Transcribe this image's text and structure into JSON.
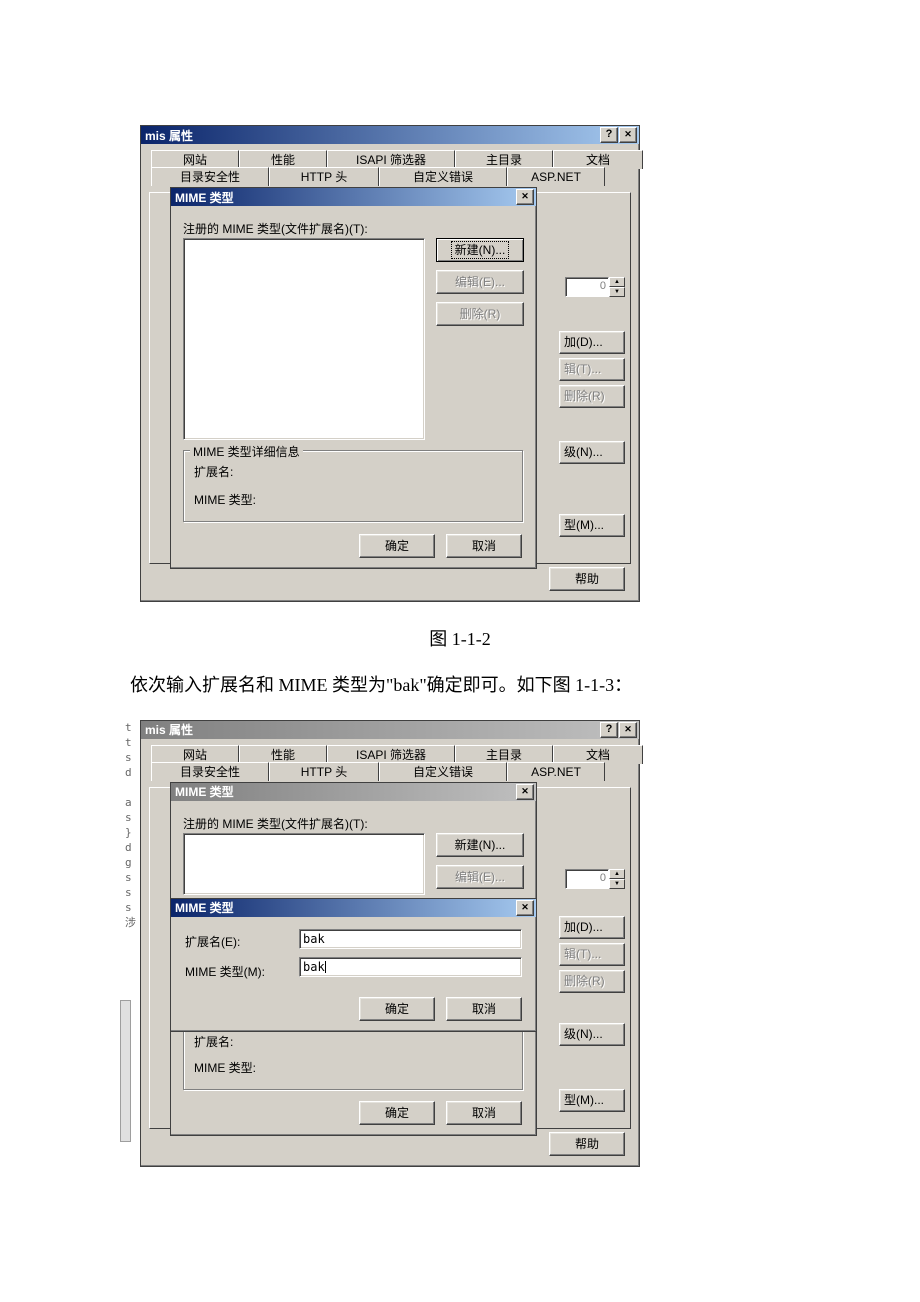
{
  "doc": {
    "caption1": "图 1-1-2",
    "paragraph": "依次输入扩展名和 MIME 类型为\"bak\"确定即可。如下图 1-1-3：",
    "crop_letters": "t\nt\ns\nd\n \na\ns\n}\nd\ng\ns\ns\ns\n涉"
  },
  "props_window": {
    "title": "mis 属性",
    "tabs_back": [
      "网站",
      "性能",
      "ISAPI 筛选器",
      "主目录",
      "文档"
    ],
    "tabs_front": [
      "目录安全性",
      "HTTP 头",
      "自定义错误",
      "ASP.NET"
    ],
    "help_button": "帮助",
    "spinner_value": "0",
    "side_buttons": {
      "add": "加(D)...",
      "edit": "辑(T)...",
      "delete": "删除(R)",
      "level": "级(N)...",
      "type": "型(M)..."
    }
  },
  "mime_dialog": {
    "title": "MIME 类型",
    "list_label": "注册的 MIME 类型(文件扩展名)(T):",
    "btn_new": "新建(N)...",
    "btn_edit": "编辑(E)...",
    "btn_delete": "删除(R)",
    "group_title": "MIME 类型详细信息",
    "ext_label": "扩展名:",
    "mime_label": "MIME 类型:",
    "ok": "确定",
    "cancel": "取消"
  },
  "mime_add_dialog": {
    "title": "MIME 类型",
    "ext_label": "扩展名(E):",
    "mime_label": "MIME 类型(M):",
    "ext_value": "bak",
    "mime_value": "bak",
    "ok": "确定",
    "cancel": "取消"
  }
}
